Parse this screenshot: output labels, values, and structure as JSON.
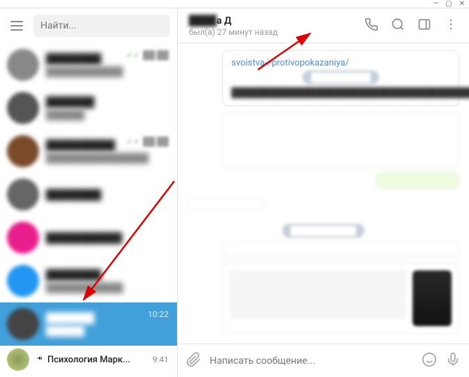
{
  "window": {
    "minimize": "—",
    "maximize": "▢",
    "close": "✕"
  },
  "sidebar": {
    "search_placeholder": "Найти...",
    "chats": [
      {
        "name": "████████",
        "preview": "████████████",
        "time": "██:██",
        "avatar_color": "#888"
      },
      {
        "name": "███████",
        "preview": "██████",
        "time": "",
        "avatar_color": "#555"
      },
      {
        "name": "██████████",
        "preview": "████████████████",
        "time": "██:██",
        "avatar_color": "#7a4a2a"
      },
      {
        "name": "████████",
        "preview": "",
        "time": "",
        "avatar_color": "#666"
      },
      {
        "name": "███████████",
        "preview": "",
        "time": "",
        "avatar_color": "#e91e8c"
      },
      {
        "name": "████████",
        "preview": "████████████",
        "time": "",
        "avatar_color": "#2196f3"
      },
      {
        "name": "███████",
        "preview": "██████",
        "time": "10:22",
        "avatar_color": "#444",
        "selected": true
      }
    ],
    "bottom_chat": {
      "name": "Психология Марк...",
      "time": "9:41"
    }
  },
  "chat": {
    "title_hidden": "████",
    "title_visible": "а Д",
    "status": "был(а) 27 минут назад",
    "link_text": "svoistva-i-protivopokazaniya/",
    "input_placeholder": "Написать сообщение..."
  }
}
